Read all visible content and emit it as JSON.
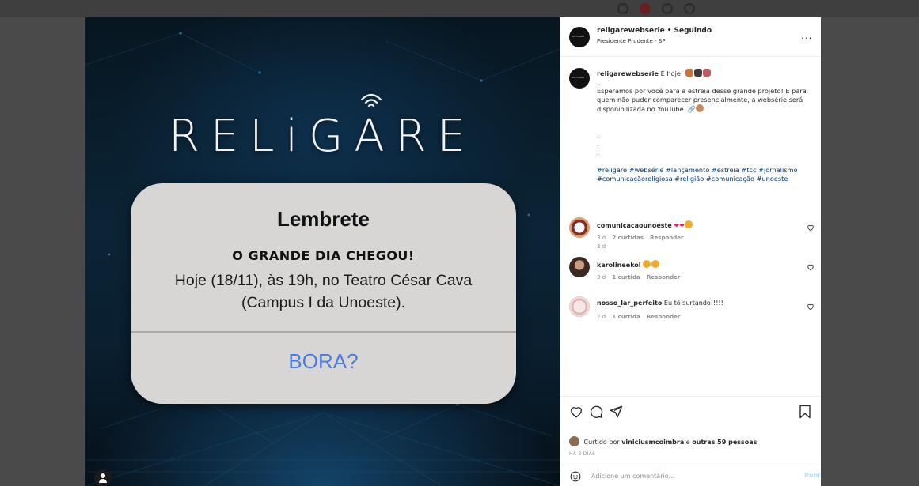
{
  "post": {
    "brand_text": "RELiGARE",
    "alert": {
      "title": "Lembrete",
      "subtitle": "O GRANDE DIA CHEGOU!",
      "message": "Hoje (18/11), às 19h, no Teatro César Cava (Campus I da Unoeste).",
      "action": "BORA?"
    }
  },
  "header": {
    "username": "religarewebserie",
    "separator": "•",
    "follow_status": "Seguindo",
    "location": "Presidente Prudente - SP",
    "more": "..."
  },
  "caption": {
    "username": "religarewebserie",
    "lead": "É hoje!",
    "dot1": ".",
    "body": "Esperamos por você para a estreia desse grande projeto! E para quem não puder comparecer presencialmente, a websérie será disponibilizada no YouTube.",
    "dots": [
      ".",
      ".",
      "."
    ],
    "hashtags": "#religare #websérie #lançamento #estreia #tcc #jornalismo #comunicaçãoreligiosa #religião #comunicação #unoeste",
    "time": "3 d"
  },
  "comments": [
    {
      "username": "comunicacaounoeste",
      "text": "",
      "time": "3 d",
      "likes": "2 curtidas",
      "reply": "Responder"
    },
    {
      "username": "karolineekol",
      "text": "",
      "time": "3 d",
      "likes": "1 curtida",
      "reply": "Responder"
    },
    {
      "username": "nosso_lar_perfeito",
      "text": "Eu tô surtando!!!!!",
      "time": "2 d",
      "likes": "1 curtida",
      "reply": "Responder"
    }
  ],
  "likes": {
    "prefix": "Curtido por",
    "user": "viniciusmcoimbra",
    "middle": "e",
    "others": "outras 59 pessoas"
  },
  "date_label": "HÁ 3 DIAS",
  "comment_box": {
    "placeholder": "Adicione um comentário...",
    "publish": "Publicar"
  },
  "colors": {
    "link": "#00376b",
    "publish_disabled": "#b2dffc",
    "alert_action": "#4c7be0",
    "heart": "#ed4956"
  }
}
